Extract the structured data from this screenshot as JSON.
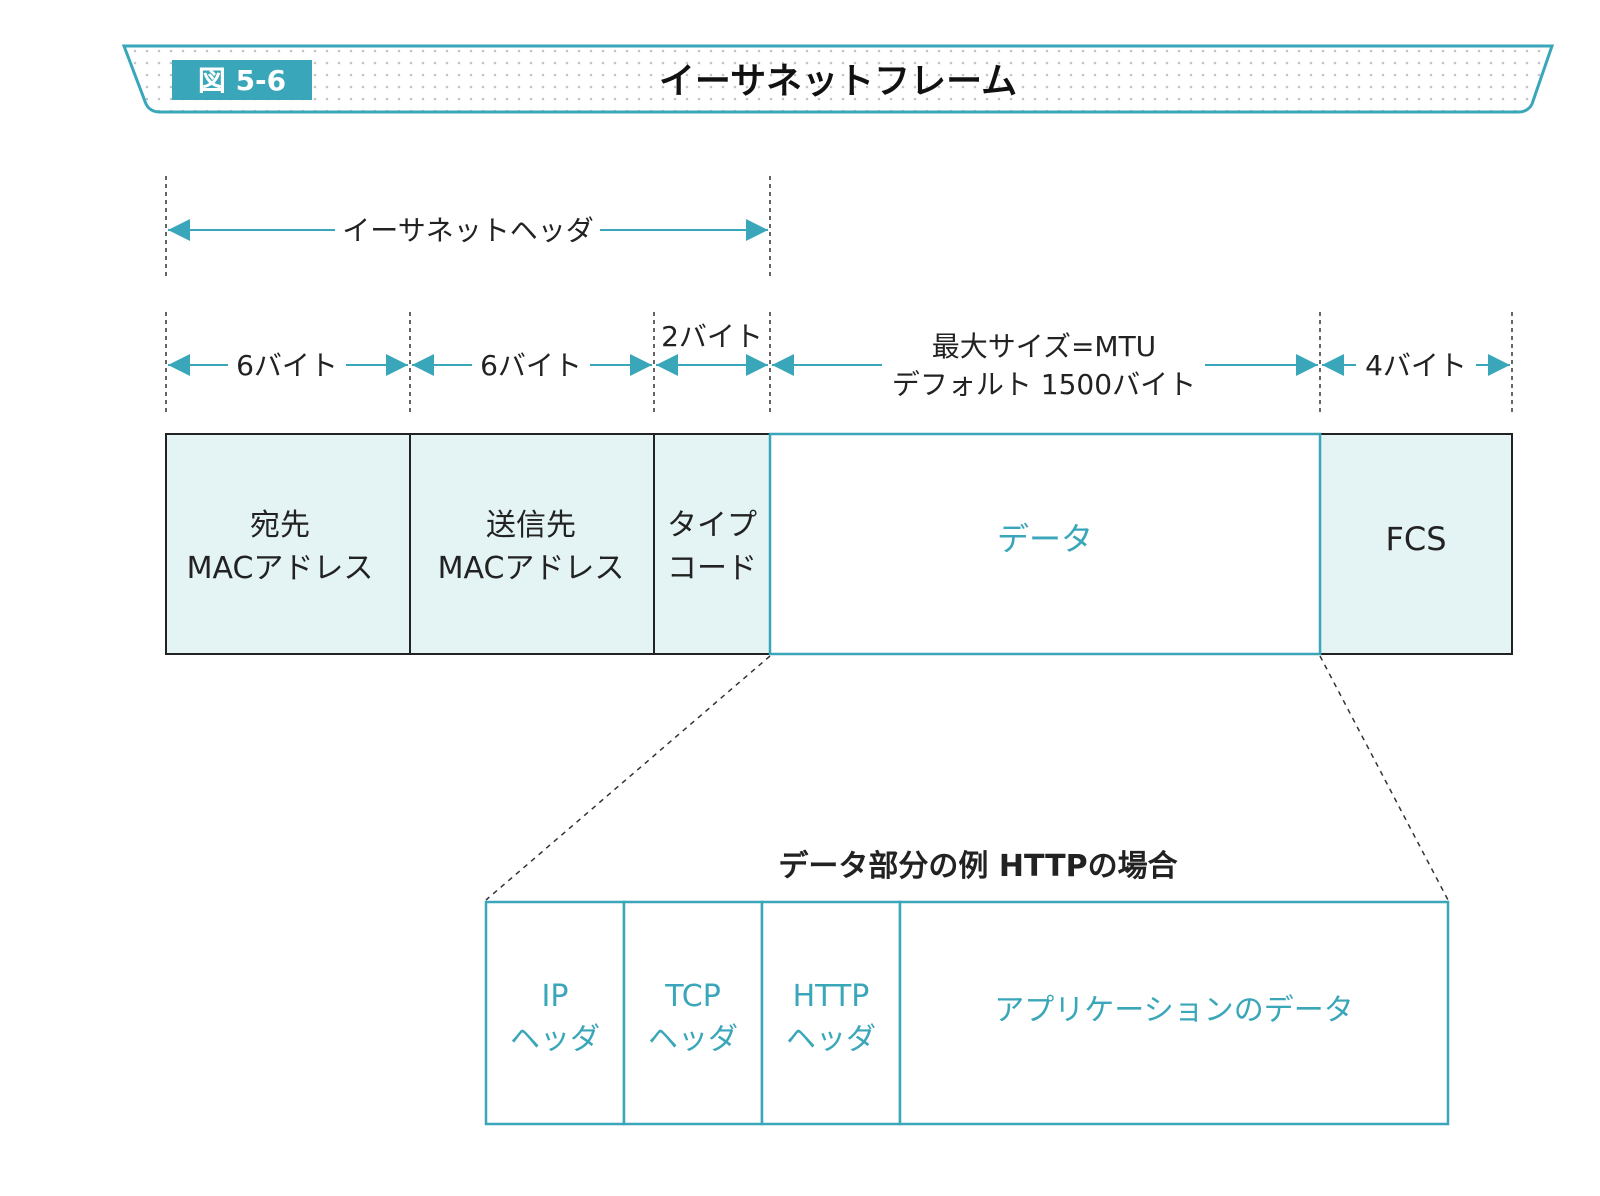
{
  "colors": {
    "accent": "#3aa6b9",
    "header_fill": "#e4f3f4",
    "frame_border": "#222222",
    "text_dark": "#222222"
  },
  "banner": {
    "figure_label": "図 5-6",
    "title": "イーサネットフレーム"
  },
  "header_span": {
    "label": "イーサネットヘッダ"
  },
  "sizes": {
    "dest": "6バイト",
    "src": "6バイト",
    "type": "2バイト",
    "data_line1": "最大サイズ=MTU",
    "data_line2": "デフォルト 1500バイト",
    "fcs": "4バイト"
  },
  "fields": {
    "dest_line1": "宛先",
    "dest_line2": "MACアドレス",
    "src_line1": "送信先",
    "src_line2": "MACアドレス",
    "type_line1": "タイプ",
    "type_line2": "コード",
    "data": "データ",
    "fcs": "FCS"
  },
  "example": {
    "title": "データ部分の例 HTTPの場合",
    "ip_line1": "IP",
    "ip_line2": "ヘッダ",
    "tcp_line1": "TCP",
    "tcp_line2": "ヘッダ",
    "http_line1": "HTTP",
    "http_line2": "ヘッダ",
    "app_data": "アプリケーションのデータ"
  }
}
